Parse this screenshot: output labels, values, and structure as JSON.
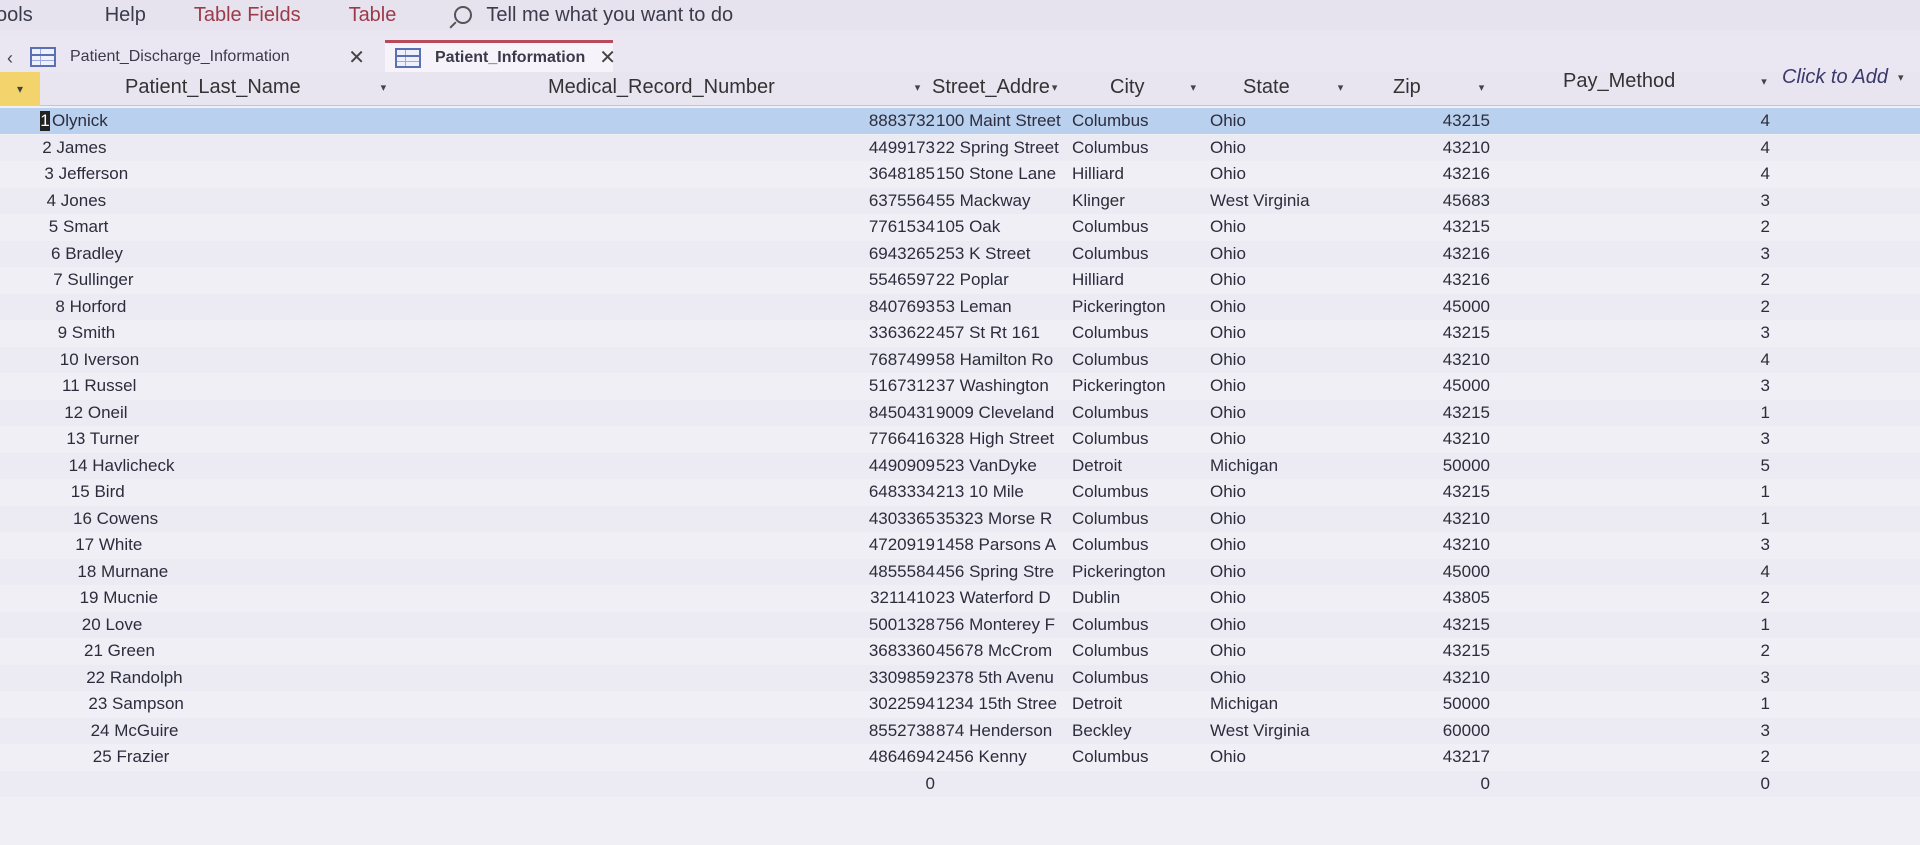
{
  "menubar": {
    "items": [
      "ools",
      "Help",
      "Table Fields",
      "Table"
    ],
    "tell_me": "Tell me what you want to do"
  },
  "tabs": [
    {
      "label": "Patient_Discharge_Information",
      "active": false
    },
    {
      "label": "Patient_Information",
      "active": true
    }
  ],
  "columns": {
    "name": "Patient_Last_Name",
    "mrn": "Medical_Record_Number",
    "street": "Street_Addre",
    "city": "City",
    "state": "State",
    "zip": "Zip",
    "pay": "Pay_Method",
    "add": "Click to Add"
  },
  "rows": [
    {
      "id": "1",
      "name": "Olynick",
      "mrn": "8883732",
      "street": "100 Maint Street",
      "city": "Columbus",
      "state": "Ohio",
      "zip": "43215",
      "pay": "4"
    },
    {
      "id": "2",
      "name": "James",
      "mrn": "4499173",
      "street": "22 Spring Street",
      "city": "Columbus",
      "state": "Ohio",
      "zip": "43210",
      "pay": "4"
    },
    {
      "id": "3",
      "name": "Jefferson",
      "mrn": "3648185",
      "street": "150 Stone Lane",
      "city": "Hilliard",
      "state": "Ohio",
      "zip": "43216",
      "pay": "4"
    },
    {
      "id": "4",
      "name": "Jones",
      "mrn": "6375564",
      "street": "55 Mackway",
      "city": "Klinger",
      "state": "West Virginia",
      "zip": "45683",
      "pay": "3"
    },
    {
      "id": "5",
      "name": "Smart",
      "mrn": "7761534",
      "street": "105 Oak",
      "city": "Columbus",
      "state": "Ohio",
      "zip": "43215",
      "pay": "2"
    },
    {
      "id": "6",
      "name": "Bradley",
      "mrn": "6943265",
      "street": "253 K Street",
      "city": "Columbus",
      "state": "Ohio",
      "zip": "43216",
      "pay": "3"
    },
    {
      "id": "7",
      "name": "Sullinger",
      "mrn": "5546597",
      "street": "22 Poplar",
      "city": "Hilliard",
      "state": "Ohio",
      "zip": "43216",
      "pay": "2"
    },
    {
      "id": "8",
      "name": "Horford",
      "mrn": "8407693",
      "street": "53 Leman",
      "city": "Pickerington",
      "state": "Ohio",
      "zip": "45000",
      "pay": "2"
    },
    {
      "id": "9",
      "name": "Smith",
      "mrn": "3363622",
      "street": "457 St Rt 161",
      "city": "Columbus",
      "state": "Ohio",
      "zip": "43215",
      "pay": "3"
    },
    {
      "id": "10",
      "name": "Iverson",
      "mrn": "7687499",
      "street": "58 Hamilton Ro",
      "city": "Columbus",
      "state": "Ohio",
      "zip": "43210",
      "pay": "4"
    },
    {
      "id": "11",
      "name": "Russel",
      "mrn": "5167312",
      "street": "37 Washington",
      "city": "Pickerington",
      "state": "Ohio",
      "zip": "45000",
      "pay": "3"
    },
    {
      "id": "12",
      "name": "Oneil",
      "mrn": "8450431",
      "street": "9009 Cleveland",
      "city": "Columbus",
      "state": "Ohio",
      "zip": "43215",
      "pay": "1"
    },
    {
      "id": "13",
      "name": "Turner",
      "mrn": "7766416",
      "street": "328 High Street",
      "city": "Columbus",
      "state": "Ohio",
      "zip": "43210",
      "pay": "3"
    },
    {
      "id": "14",
      "name": "Havlicheck",
      "mrn": "4490909",
      "street": "523 VanDyke",
      "city": "Detroit",
      "state": "Michigan",
      "zip": "50000",
      "pay": "5"
    },
    {
      "id": "15",
      "name": "Bird",
      "mrn": "6483334",
      "street": "213 10 Mile",
      "city": "Columbus",
      "state": "Ohio",
      "zip": "43215",
      "pay": "1"
    },
    {
      "id": "16",
      "name": "Cowens",
      "mrn": "4303365",
      "street": "35323 Morse R",
      "city": "Columbus",
      "state": "Ohio",
      "zip": "43210",
      "pay": "1"
    },
    {
      "id": "17",
      "name": "White",
      "mrn": "4720919",
      "street": "1458 Parsons A",
      "city": "Columbus",
      "state": "Ohio",
      "zip": "43210",
      "pay": "3"
    },
    {
      "id": "18",
      "name": "Murnane",
      "mrn": "4855584",
      "street": "456 Spring Stre",
      "city": "Pickerington",
      "state": "Ohio",
      "zip": "45000",
      "pay": "4"
    },
    {
      "id": "19",
      "name": "Mucnie",
      "mrn": "3211410",
      "street": "23 Waterford D",
      "city": "Dublin",
      "state": "Ohio",
      "zip": "43805",
      "pay": "2"
    },
    {
      "id": "20",
      "name": "Love",
      "mrn": "5001328",
      "street": "756 Monterey F",
      "city": "Columbus",
      "state": "Ohio",
      "zip": "43215",
      "pay": "1"
    },
    {
      "id": "21",
      "name": "Green",
      "mrn": "3683360",
      "street": "45678 McCrom",
      "city": "Columbus",
      "state": "Ohio",
      "zip": "43215",
      "pay": "2"
    },
    {
      "id": "22",
      "name": "Randolph",
      "mrn": "3309859",
      "street": "2378 5th Avenu",
      "city": "Columbus",
      "state": "Ohio",
      "zip": "43210",
      "pay": "3"
    },
    {
      "id": "23",
      "name": "Sampson",
      "mrn": "3022594",
      "street": "1234 15th Stree",
      "city": "Detroit",
      "state": "Michigan",
      "zip": "50000",
      "pay": "1"
    },
    {
      "id": "24",
      "name": "McGuire",
      "mrn": "8552738",
      "street": "874 Henderson",
      "city": "Beckley",
      "state": "West Virginia",
      "zip": "60000",
      "pay": "3"
    },
    {
      "id": "25",
      "name": "Frazier",
      "mrn": "4864694",
      "street": "2456 Kenny",
      "city": "Columbus",
      "state": "Ohio",
      "zip": "43217",
      "pay": "2"
    },
    {
      "id": "",
      "name": "",
      "mrn": "0",
      "street": "",
      "city": "",
      "state": "",
      "zip": "0",
      "pay": "0"
    }
  ]
}
